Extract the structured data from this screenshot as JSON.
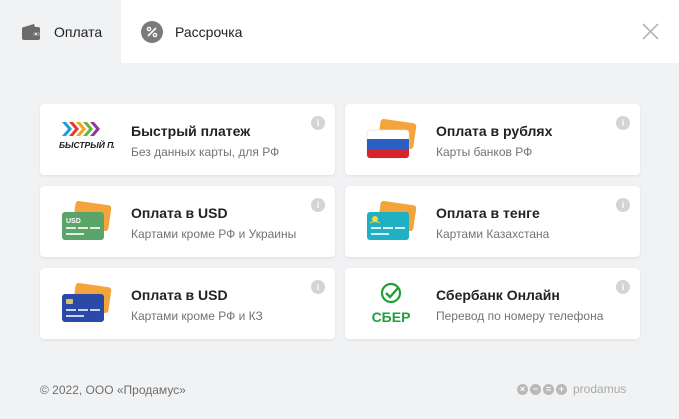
{
  "tabs": {
    "payment": "Оплата",
    "installment": "Рассрочка"
  },
  "cards": [
    {
      "title": "Быстрый платеж",
      "subtitle": "Без данных карты, для РФ",
      "logo_text": "БЫСТРЫЙ ПЛАТЕЖ",
      "icon": "sbp-logo"
    },
    {
      "title": "Оплата в рублях",
      "subtitle": "Карты банков РФ",
      "icon": "rub-card-icon"
    },
    {
      "title": "Оплата в USD",
      "subtitle": "Картами кроме РФ и Украины",
      "logo_text": "USD",
      "icon": "usd-card-icon"
    },
    {
      "title": "Оплата в тенге",
      "subtitle": "Картами Казахстана",
      "icon": "kzt-card-icon"
    },
    {
      "title": "Оплата в USD",
      "subtitle": "Картами кроме РФ и КЗ",
      "icon": "usd-blue-card-icon"
    },
    {
      "title": "Сбербанк Онлайн",
      "subtitle": "Перевод по номеру телефона",
      "logo_text": "СБЕР",
      "icon": "sber-logo"
    }
  ],
  "footer": {
    "copyright": "© 2022, ООО «Продамус»",
    "brand": "prodamus"
  },
  "colors": {
    "background": "#f1f2f4",
    "card": "#ffffff",
    "sber_green": "#21a038",
    "usd_green": "#5aa46a",
    "kzt_teal": "#1fb0c4",
    "usd_blue": "#2b4aa8",
    "card_orange": "#f3a53c"
  }
}
